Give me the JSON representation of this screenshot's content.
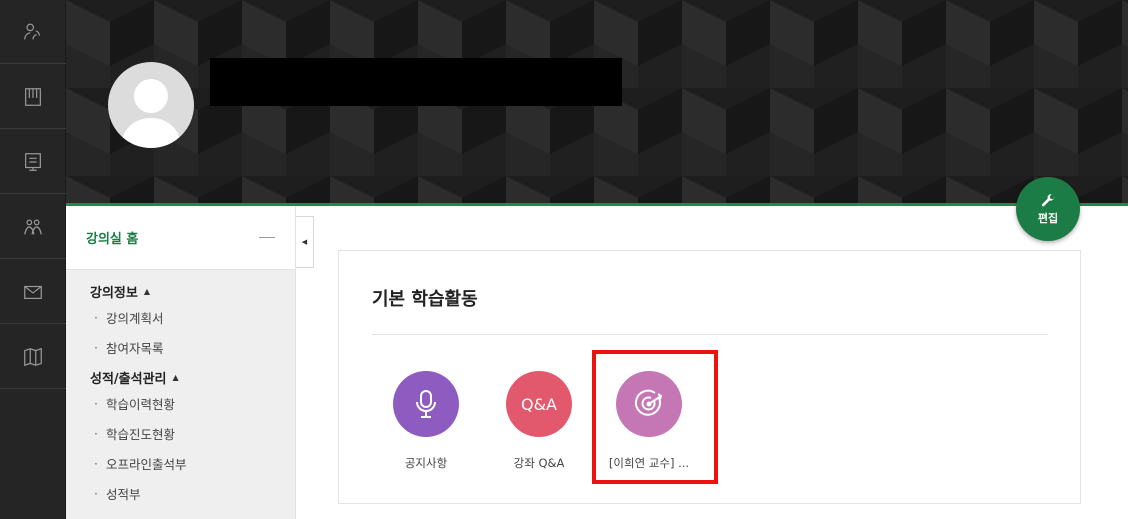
{
  "rail": {
    "items": [
      {
        "icon": "people-icon"
      },
      {
        "icon": "book-icon"
      },
      {
        "icon": "presentation-board-icon"
      },
      {
        "icon": "group-icon"
      },
      {
        "icon": "mail-icon"
      },
      {
        "icon": "map-icon"
      }
    ]
  },
  "banner": {
    "edit_label": "편집"
  },
  "sidebar": {
    "home_label": "강의실 홈",
    "sections": [
      {
        "title": "강의정보",
        "items": [
          "강의계획서",
          "참여자목록"
        ]
      },
      {
        "title": "성적/출석관리",
        "items": [
          "학습이력현황",
          "학습진도현황",
          "오프라인출석부",
          "성적부"
        ]
      }
    ]
  },
  "main": {
    "section_title": "기본 학습활동",
    "activities": [
      {
        "label": "공지사항",
        "icon": "microphone-icon",
        "color": "#8e5cc0"
      },
      {
        "label": "강좌 Q&A",
        "icon_text": "Q&A",
        "color": "#e2596e"
      },
      {
        "label": "[이희연 교수] ...",
        "icon": "target-icon",
        "color": "#c577b5"
      }
    ]
  },
  "colors": {
    "accent": "#1c7c45",
    "rail_bg": "#252525",
    "highlight": "#ee1111"
  }
}
